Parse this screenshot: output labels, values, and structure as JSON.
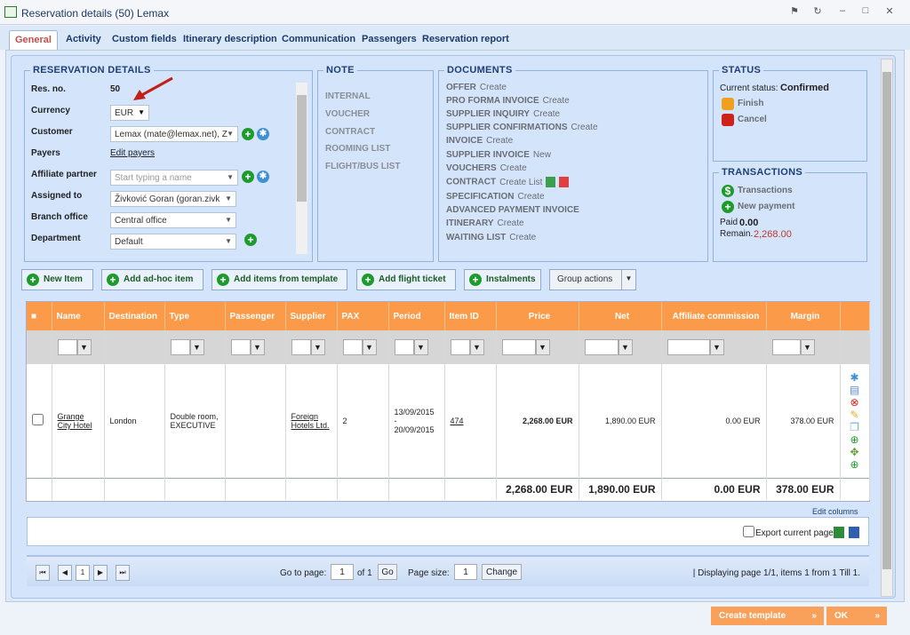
{
  "window": {
    "title": "Reservation details (50) Lemax"
  },
  "tabs": [
    "General",
    "Activity",
    "Custom fields",
    "Itinerary description",
    "Communication",
    "Passengers",
    "Reservation report"
  ],
  "reservation_details": {
    "legend": "RESERVATION DETAILS",
    "res_no_label": "Res. no.",
    "res_no": "50",
    "currency_label": "Currency",
    "currency": "EUR",
    "customer_label": "Customer",
    "customer": "Lemax (mate@lemax.net), Z",
    "payers_label": "Payers",
    "payers_link": "Edit payers",
    "affiliate_label": "Affiliate partner",
    "affiliate_placeholder": "Start typing a name",
    "assigned_label": "Assigned to",
    "assigned": "Živković Goran (goran.zivk",
    "branch_label": "Branch office",
    "branch": "Central office",
    "department_label": "Department",
    "department": "Default"
  },
  "note": {
    "legend": "NOTE",
    "items": [
      "INTERNAL",
      "VOUCHER",
      "CONTRACT",
      "ROOMING LIST",
      "FLIGHT/BUS LIST"
    ]
  },
  "documents": {
    "legend": "DOCUMENTS",
    "items": [
      {
        "name": "OFFER",
        "actions": "Create"
      },
      {
        "name": "PRO FORMA INVOICE",
        "actions": "Create"
      },
      {
        "name": "SUPPLIER INQUIRY",
        "actions": "Create"
      },
      {
        "name": "SUPPLIER CONFIRMATIONS",
        "actions": "Create"
      },
      {
        "name": "INVOICE",
        "actions": "Create"
      },
      {
        "name": "SUPPLIER INVOICE",
        "actions": "New"
      },
      {
        "name": "VOUCHERS",
        "actions": "Create"
      },
      {
        "name": "CONTRACT",
        "actions": "Create  List"
      },
      {
        "name": "SPECIFICATION",
        "actions": "Create"
      },
      {
        "name": "ADVANCED PAYMENT INVOICE",
        "actions": ""
      },
      {
        "name": "ITINERARY",
        "actions": "Create"
      },
      {
        "name": "WAITING LIST",
        "actions": "Create"
      }
    ]
  },
  "status": {
    "legend": "STATUS",
    "label": "Current status:",
    "value": "Confirmed",
    "finish": "Finish",
    "cancel": "Cancel"
  },
  "transactions": {
    "legend": "TRANSACTIONS",
    "transactions": "Transactions",
    "new_payment": "New payment",
    "paid_label": "Paid",
    "paid": "0.00",
    "remain_label": "Remain.",
    "remain": "2,268.00",
    "remain_color": "#c0392b"
  },
  "toolbar": {
    "new_item": "New Item",
    "adhoc": "Add ad-hoc item",
    "template": "Add items from template",
    "flight": "Add flight ticket",
    "instalments": "Instalments",
    "group_actions": "Group actions"
  },
  "grid": {
    "columns": [
      "Name",
      "Destination",
      "Type",
      "Passenger",
      "Supplier",
      "PAX",
      "Period",
      "Item ID",
      "Price",
      "Net",
      "Affiliate commission",
      "Margin"
    ],
    "row": {
      "name": "Grange City Hotel",
      "destination": "London",
      "type": "Double room, EXECUTIVE",
      "passenger": "",
      "supplier": "Foreign Hotels Ltd.",
      "pax": "2",
      "period": "13/09/2015 - 20/09/2015",
      "item_id": "474",
      "price": "2,268.00 EUR",
      "net": "1,890.00 EUR",
      "affiliate": "0.00 EUR",
      "margin": "378.00 EUR"
    },
    "totals": {
      "price": "2,268.00 EUR",
      "net": "1,890.00 EUR",
      "affiliate": "0.00 EUR",
      "margin": "378.00 EUR"
    },
    "edit_columns": "Edit columns",
    "export": "Export current page"
  },
  "pager": {
    "current": "1",
    "goto_label": "Go to page:",
    "goto_value": "1",
    "of": "of 1",
    "go": "Go",
    "size_label": "Page size:",
    "size": "1",
    "change": "Change",
    "info": "| Displaying page  1/1,  items  1  from  1  Till  1."
  },
  "footer": {
    "create_template": "Create template",
    "ok": "OK"
  },
  "colors": {
    "header": "#fb9a48",
    "accent": "#1f3f78"
  }
}
